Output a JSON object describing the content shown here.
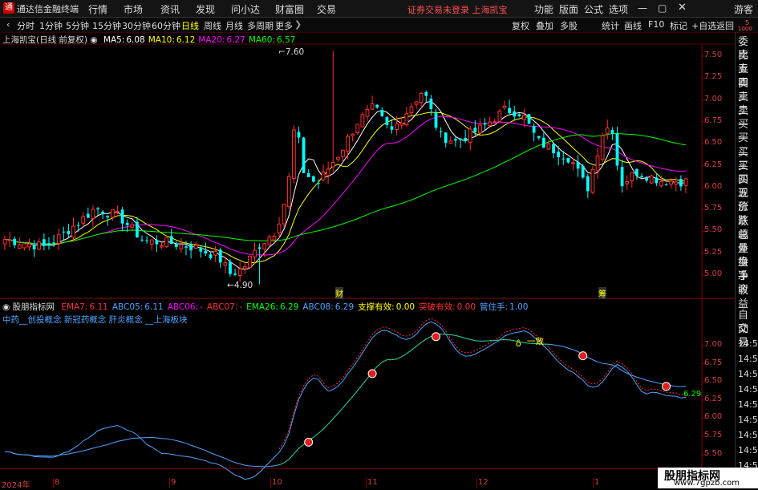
{
  "topbar": {
    "app_title": "通达信金融终端",
    "menus": [
      "行情",
      "市场",
      "资讯",
      "发现",
      "问小达",
      "财富圈",
      "交易"
    ],
    "notice": "证券交易未登录  上海凯宝",
    "right_menus": [
      "功能",
      "版面",
      "公式",
      "选项"
    ],
    "guest": "游客"
  },
  "toolbar": {
    "periods": [
      "分时",
      "1分钟",
      "5分钟",
      "15分钟",
      "30分钟",
      "60分钟",
      "日线",
      "周线",
      "月线",
      "多周期",
      "更多"
    ],
    "active": "日线",
    "right": [
      "复权",
      "叠加",
      "多股",
      "统计",
      "画线",
      "F10",
      "标记",
      "+自选",
      "返回"
    ]
  },
  "main_info": {
    "title": "上海凯宝(日线 前复权)",
    "ma": [
      {
        "label": "MA5:",
        "value": "6.08",
        "color": "#ffffff"
      },
      {
        "label": "MA10:",
        "value": "6.12",
        "color": "#ffff00"
      },
      {
        "label": "MA20:",
        "value": "6.27",
        "color": "#ff00ff"
      },
      {
        "label": "MA60:",
        "value": "6.57",
        "color": "#00ff00"
      }
    ],
    "high_label": "7.60",
    "low_label": "4.90",
    "marker_cai": "财",
    "marker_chou": "筹"
  },
  "price_axis": [
    "7.50",
    "7.25",
    "7.00",
    "6.75",
    "6.50",
    "6.25",
    "6.00",
    "5.75",
    "5.50",
    "5.25",
    "5.00"
  ],
  "indicator": {
    "name": "股朋指标网",
    "items": [
      {
        "label": "EMA7:",
        "value": "6.11",
        "color": "#ff3030"
      },
      {
        "label": "ABC05:",
        "value": "6.11",
        "color": "#4fa3ff"
      },
      {
        "label": "ABC06:",
        "value": "-",
        "color": "#ff00ff"
      },
      {
        "label": "ABC07:",
        "value": "-",
        "color": "#ff3030"
      },
      {
        "label": "EMA26:",
        "value": "6.29",
        "color": "#00ff00"
      },
      {
        "label": "ABC08:",
        "value": "6.29",
        "color": "#4fa3ff"
      },
      {
        "label": "支撑有效:",
        "value": "0.00",
        "color": "#ffff00"
      },
      {
        "label": "突破有效:",
        "value": "0.00",
        "color": "#ff3030"
      },
      {
        "label": "管住手:",
        "value": "1.00",
        "color": "#4fa3ff"
      }
    ],
    "concepts": "中药__创投概念  新冠药概念  肝炎概念  __上海板块",
    "yizhi": "一致",
    "end_label": "6.29",
    "axis": [
      "7.00",
      "6.75",
      "6.50",
      "6.25",
      "6.00",
      "5.75",
      "5.50",
      "5.25"
    ]
  },
  "date_axis": [
    "2024年",
    "8",
    "9",
    "10",
    "11",
    "12",
    "1",
    "2"
  ],
  "right_panel": {
    "top_labels": [
      "委比",
      "卖五",
      "卖四",
      "卖三",
      "卖二",
      "卖一",
      "买一",
      "买二",
      "买三",
      "买四",
      "买五",
      "现价",
      "涨跌",
      "涨幅",
      "总量",
      "外盘",
      "换手",
      "净资",
      "收益"
    ],
    "bottom_labels": [
      "自动",
      "交易"
    ],
    "time_labels": [
      "14:56",
      "14:56",
      "14:56",
      "14:56",
      "14:56",
      "14:56",
      "14:56",
      "14:56",
      "14:56"
    ],
    "corner": "5",
    "corner2": "1000"
  },
  "watermark": {
    "title": "股朋指标网",
    "url": "www.7gpzb.com"
  },
  "chart_data": {
    "type": "candlestick",
    "ylim": [
      4.85,
      7.65
    ],
    "colors": {
      "up": "#ff3030",
      "down": "#00ffff",
      "ma5": "#ffffff",
      "ma10": "#ffff00",
      "ma20": "#ff00ff",
      "ma60": "#00ff00"
    }
  }
}
